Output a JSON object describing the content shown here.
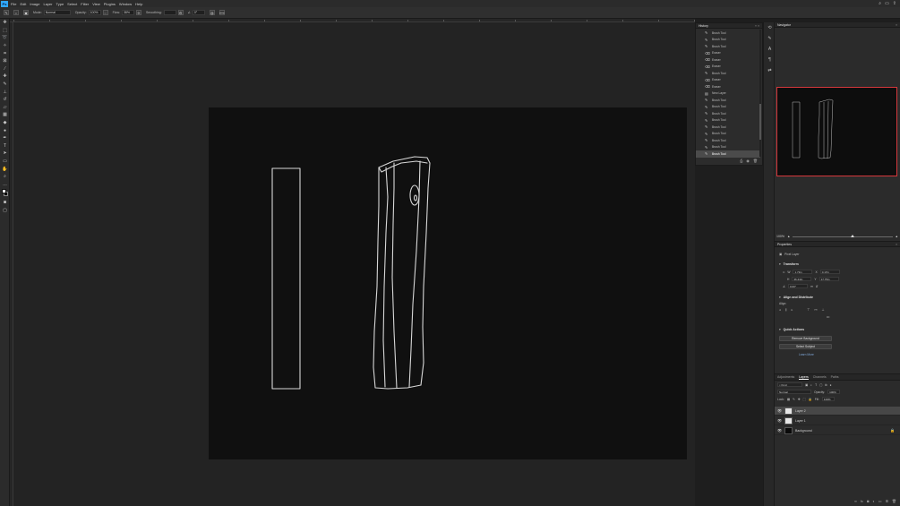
{
  "menubar": {
    "logo": "Ps",
    "menus": [
      "File",
      "Edit",
      "Image",
      "Layer",
      "Type",
      "Select",
      "Filter",
      "View",
      "Plugins",
      "Window",
      "Help"
    ]
  },
  "options": {
    "mode_label": "Mode:",
    "mode_value": "Normal",
    "opacity_label": "Opacity:",
    "opacity_value": "100%",
    "flow_label": "Flow:",
    "flow_value": "38%",
    "smoothing_label": "Smoothing:",
    "angle_value": "0°"
  },
  "history": {
    "title": "History",
    "items": [
      {
        "label": "Brush Tool",
        "icon": "brush-icon"
      },
      {
        "label": "Brush Tool",
        "icon": "brush-icon"
      },
      {
        "label": "Brush Tool",
        "icon": "brush-icon"
      },
      {
        "label": "Eraser",
        "icon": "eraser-icon"
      },
      {
        "label": "Eraser",
        "icon": "eraser-icon"
      },
      {
        "label": "Eraser",
        "icon": "eraser-icon"
      },
      {
        "label": "Brush Tool",
        "icon": "brush-icon"
      },
      {
        "label": "Eraser",
        "icon": "eraser-icon"
      },
      {
        "label": "Eraser",
        "icon": "eraser-icon"
      },
      {
        "label": "New Layer",
        "icon": "new-layer-icon"
      },
      {
        "label": "Brush Tool",
        "icon": "brush-icon"
      },
      {
        "label": "Brush Tool",
        "icon": "brush-icon"
      },
      {
        "label": "Brush Tool",
        "icon": "brush-icon"
      },
      {
        "label": "Brush Tool",
        "icon": "brush-icon"
      },
      {
        "label": "Brush Tool",
        "icon": "brush-icon"
      },
      {
        "label": "Brush Tool",
        "icon": "brush-icon"
      },
      {
        "label": "Brush Tool",
        "icon": "brush-icon"
      },
      {
        "label": "Brush Tool",
        "icon": "brush-icon"
      },
      {
        "label": "Brush Tool",
        "icon": "brush-icon"
      }
    ]
  },
  "navigator": {
    "title": "Navigator",
    "zoom": "100%"
  },
  "properties": {
    "title": "Properties",
    "layer_kind": "Pixel Layer",
    "transform_label": "Transform",
    "w": "1.73in",
    "h": "36.44in",
    "x": "0.17in",
    "y": "17.75in",
    "angle": "0.00°",
    "align_label": "Align and Distribute",
    "align_sub": "Align:",
    "quick_actions_label": "Quick Actions",
    "remove_bg": "Remove Background",
    "select_subject": "Select Subject",
    "learn_more": "Learn More"
  },
  "layers": {
    "tabs": [
      "Adjustments",
      "Layers",
      "Channels",
      "Paths"
    ],
    "active_tab": "Layers",
    "kind": "Kind",
    "blend": "Normal",
    "opacity_label": "Opacity:",
    "opacity_value": "100%",
    "lock_label": "Lock:",
    "fill_label": "Fill:",
    "fill_value": "100%",
    "rows": [
      {
        "name": "Layer 2",
        "thumb": "white",
        "active": true
      },
      {
        "name": "Layer 1",
        "thumb": "white",
        "active": false
      },
      {
        "name": "Background",
        "thumb": "black",
        "active": false
      }
    ]
  },
  "colors": {
    "accent": "#31a8ff",
    "nav_frame": "#d5383c"
  }
}
